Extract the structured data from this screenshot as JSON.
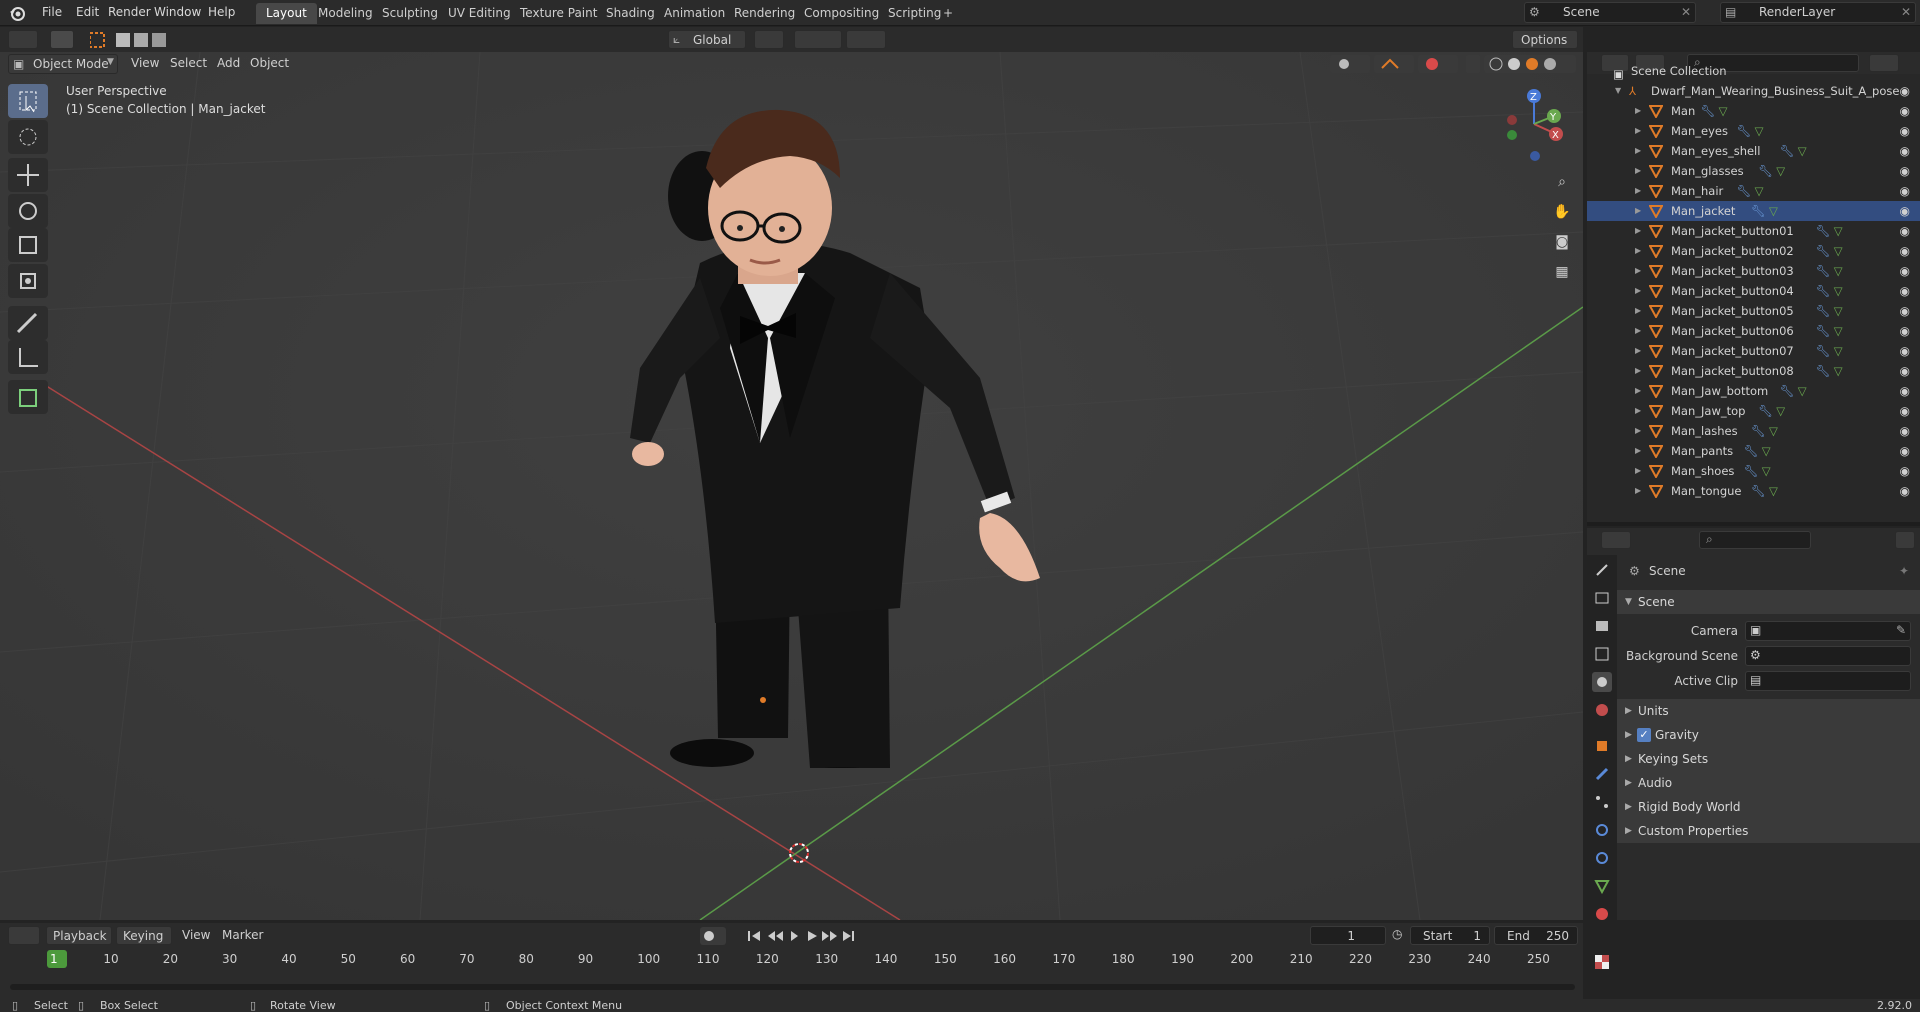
{
  "topbar": {
    "menus": [
      "File",
      "Edit",
      "Render",
      "Window",
      "Help"
    ],
    "workspaces": [
      "Layout",
      "Modeling",
      "Sculpting",
      "UV Editing",
      "Texture Paint",
      "Shading",
      "Animation",
      "Rendering",
      "Compositing",
      "Scripting"
    ],
    "add_tab": "+",
    "scene": "Scene",
    "render_layer": "RenderLayer"
  },
  "viewport": {
    "mode": "Object Mode",
    "menus": [
      "View",
      "Select",
      "Add",
      "Object"
    ],
    "orientation": "Global",
    "options": "Options",
    "view_name": "User Perspective",
    "view_info": "(1) Scene Collection | Man_jacket",
    "gizmo": {
      "x": "X",
      "y": "Y",
      "z": "Z"
    }
  },
  "outliner": {
    "root": "Scene Collection",
    "collection": "Dwarf_Man_Wearing_Business_Suit_A_pose",
    "items": [
      "Man",
      "Man_eyes",
      "Man_eyes_shell",
      "Man_glasses",
      "Man_hair",
      "Man_jacket",
      "Man_jacket_button01",
      "Man_jacket_button02",
      "Man_jacket_button03",
      "Man_jacket_button04",
      "Man_jacket_button05",
      "Man_jacket_button06",
      "Man_jacket_button07",
      "Man_jacket_button08",
      "Man_Jaw_bottom",
      "Man_Jaw_top",
      "Man_lashes",
      "Man_pants",
      "Man_shoes",
      "Man_tongue"
    ],
    "selected": "Man_jacket"
  },
  "properties": {
    "context": "Scene",
    "section": "Scene",
    "camera_label": "Camera",
    "bg_label": "Background Scene",
    "clip_label": "Active Clip",
    "panels": [
      "Units",
      "Gravity",
      "Keying Sets",
      "Audio",
      "Rigid Body World",
      "Custom Properties"
    ],
    "gravity_checked": true
  },
  "timeline": {
    "menus": [
      "Playback",
      "Keying",
      "View",
      "Marker"
    ],
    "current": "1",
    "start_label": "Start",
    "start": "1",
    "end_label": "End",
    "end": "250",
    "ticks": [
      "1",
      "10",
      "20",
      "30",
      "40",
      "50",
      "60",
      "70",
      "80",
      "90",
      "100",
      "110",
      "120",
      "130",
      "140",
      "150",
      "160",
      "170",
      "180",
      "190",
      "200",
      "210",
      "220",
      "230",
      "240",
      "250"
    ]
  },
  "status": {
    "select": "Select",
    "box_select": "Box Select",
    "rotate": "Rotate View",
    "context_menu": "Object Context Menu",
    "version": "2.92.0"
  },
  "colors": {
    "accent": "#e07b28",
    "selection": "#334d80",
    "x_axis": "#c24d4d",
    "y_axis": "#6aa84f"
  }
}
